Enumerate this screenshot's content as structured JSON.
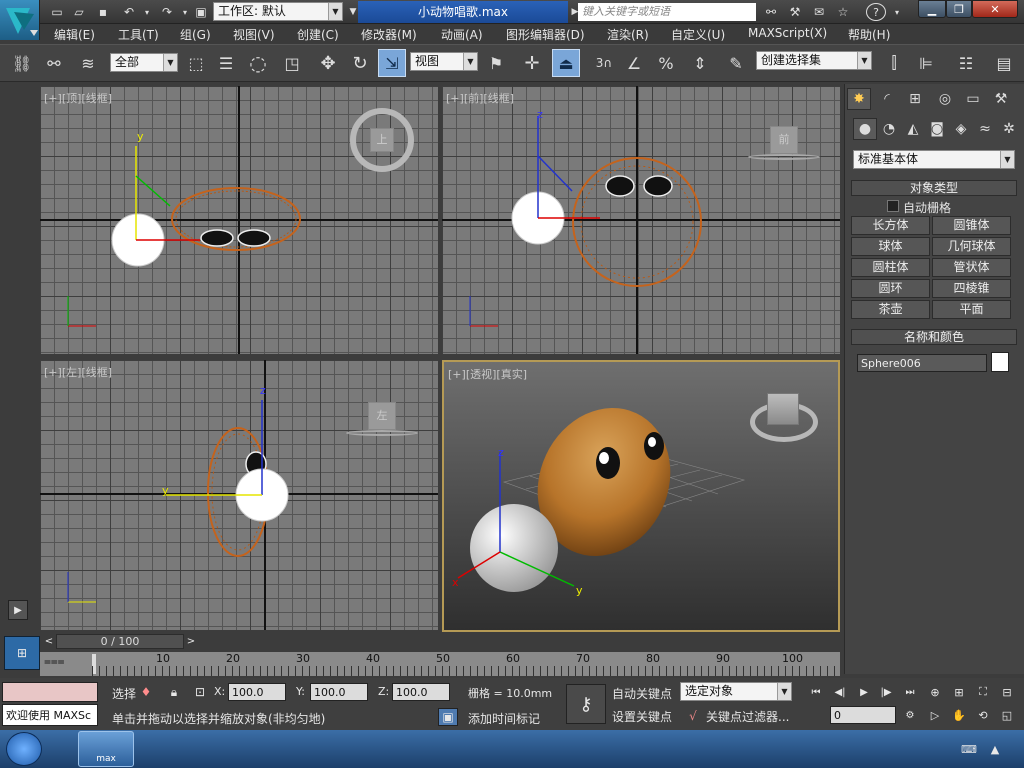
{
  "app": {
    "workspace_label": "工作区: 默认",
    "doc_title": "小动物唱歌.max",
    "search_placeholder": "键入关键字或短语",
    "accent": "#2a62b8"
  },
  "menu": {
    "items": [
      "编辑(E)",
      "工具(T)",
      "组(G)",
      "视图(V)",
      "创建(C)",
      "修改器(M)",
      "动画(A)",
      "图形编辑器(D)",
      "渲染(R)",
      "自定义(U)",
      "MAXScript(X)",
      "帮助(H)"
    ]
  },
  "toolbar": {
    "filter_value": "全部",
    "refcoord_value": "视图",
    "selection_set_value": "创建选择集",
    "snap_value": "3"
  },
  "viewports": {
    "top": {
      "bracket": "[+]",
      "view": "[顶]",
      "shade": "[线框]",
      "cube_label": "上"
    },
    "front": {
      "bracket": "[+]",
      "view": "[前]",
      "shade": "[线框]",
      "cube_label": "前"
    },
    "left": {
      "bracket": "[+]",
      "view": "[左]",
      "shade": "[线框]",
      "cube_label": "左"
    },
    "persp": {
      "bracket": "[+]",
      "view": "[透视]",
      "shade": "[真实]"
    },
    "axis_labels": {
      "x": "x",
      "y": "y",
      "z": "z"
    }
  },
  "command_panel": {
    "category_value": "标准基本体",
    "object_type_header": "对象类型",
    "autogrid_label": "自动栅格",
    "autogrid_checked": false,
    "buttons": [
      "长方体",
      "圆锥体",
      "球体",
      "几何球体",
      "圆柱体",
      "管状体",
      "圆环",
      "四棱锥",
      "茶壶",
      "平面"
    ],
    "name_color_header": "名称和颜色",
    "object_name": "Sphere006",
    "object_color": "#ffffff"
  },
  "timeline": {
    "frame_display": "0 / 100",
    "ticks": [
      "10",
      "20",
      "30",
      "40",
      "50",
      "60",
      "70",
      "80",
      "90",
      "100"
    ]
  },
  "status": {
    "maxscript_welcome": "欢迎使用 MAXSc",
    "select_label": "选择",
    "x_label": "X:",
    "x_value": "100.0",
    "y_label": "Y:",
    "y_value": "100.0",
    "z_label": "Z:",
    "z_value": "100.0",
    "grid_text": "栅格 = 10.0mm",
    "prompt": "单击并拖动以选择并缩放对象(非均匀地)",
    "add_time_tag": "添加时间标记",
    "auto_key": "自动关键点",
    "set_key": "设置关键点",
    "key_target_value": "选定对象",
    "key_filter": "关键点过滤器...",
    "current_frame": "0"
  },
  "taskbar": {
    "app_button_label": "max"
  }
}
